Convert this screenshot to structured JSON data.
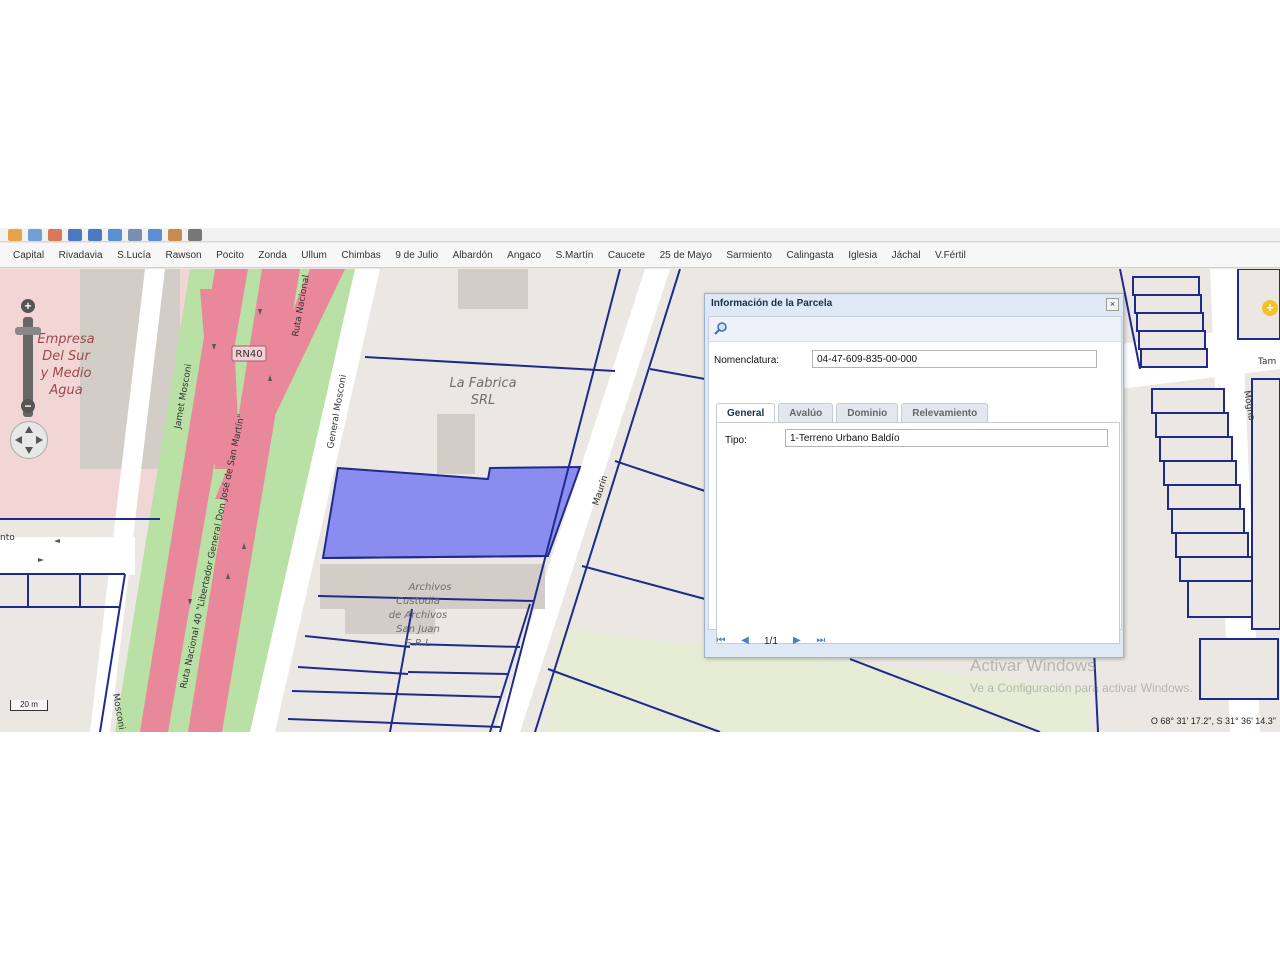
{
  "toolbar": {
    "icons": [
      "home-icon",
      "layer-icon",
      "edit-icon",
      "select-icon",
      "select-all-icon",
      "undo-icon",
      "measure-icon",
      "refresh-icon",
      "route-icon",
      "grid-icon"
    ]
  },
  "districts": [
    "Capital",
    "Rivadavia",
    "S.Lucía",
    "Rawson",
    "Pocito",
    "Zonda",
    "Ullum",
    "Chimbas",
    "9 de Julio",
    "Albardón",
    "Angaco",
    "S.Martín",
    "Caucete",
    "25 de Mayo",
    "Sarmiento",
    "Calingasta",
    "Iglesia",
    "Jáchal",
    "V.Fértil"
  ],
  "map_labels": {
    "empresa": [
      "Empresa",
      "Del Sur",
      "y Medio",
      "Agua"
    ],
    "fabrica": [
      "La Fabrica",
      "SRL"
    ],
    "archivos": [
      "Archivos",
      "Custodia",
      "de Archivos",
      "San Juan",
      "S.R.L"
    ],
    "jamet": "Jamet Mosconi",
    "general_mosconi": "General Mosconi",
    "mosconi": "Mosconi",
    "rn40_shield": "RN40",
    "ruta_nacional": "Ruta Nacional",
    "ruta_long": "Ruta Nacional 40 \"Libertador General Don José de San Martín\"",
    "maurin": "Maurín",
    "mogna": "Mogna",
    "tam": "Tam",
    "nto": "nto"
  },
  "scale_label": "20 m",
  "coords": "O 68° 31' 17.2\", S 31° 36' 14.3\"",
  "watermark": {
    "line1": "Activar Windows",
    "line2": "Ve a Configuración para activar Windows."
  },
  "dialog": {
    "title": "Información de la Parcela",
    "close": "×",
    "nomenclatura_label": "Nomenclatura:",
    "nomenclatura_value": "04-47-609-835-00-000",
    "tabs": [
      "General",
      "Avalúo",
      "Dominio",
      "Relevamiento"
    ],
    "active_tab": "General",
    "tipo_label": "Tipo:",
    "tipo_value": "1-Terreno Urbano Baldío",
    "pager_text": "1/1"
  },
  "colors": {
    "parcel_line": "#1f2a8c",
    "selected_parcel": "#8b8cf0",
    "highway": "#e8889a",
    "median": "#b9e0a5",
    "commercial": "#f2d6d6"
  }
}
